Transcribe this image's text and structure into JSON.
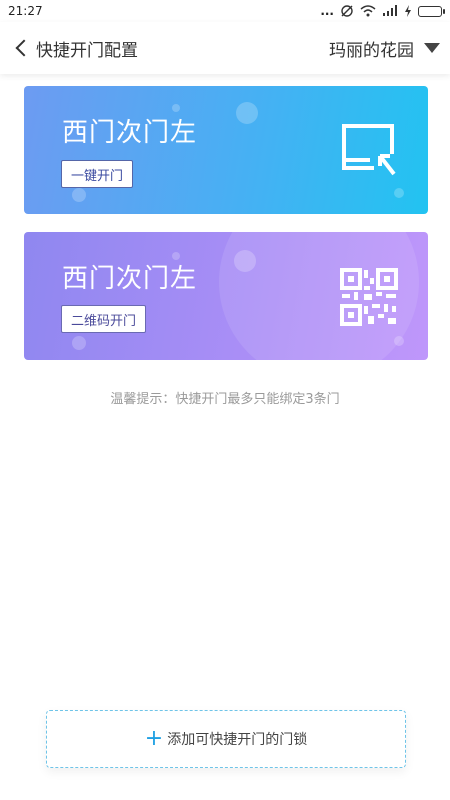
{
  "status": {
    "time": "21:27",
    "dots": "..."
  },
  "header": {
    "title": "快捷开门配置",
    "community": "玛丽的花园"
  },
  "cards": [
    {
      "door": "西门次门左",
      "button": "一键开门",
      "icon": "open-door-icon"
    },
    {
      "door": "西门次门左",
      "button": "二维码开门",
      "icon": "qr-code-icon"
    }
  ],
  "hint": "温馨提示：快捷开门最多只能绑定3条门",
  "add_button": {
    "label": "添加可快捷开门的门锁",
    "icon": "plus-icon"
  },
  "colors": {
    "card1_start": "#6d9bf2",
    "card1_end": "#22c3f1",
    "card2_start": "#8f87f0",
    "card2_end": "#bf97fb",
    "accent": "#1fa0e3"
  }
}
